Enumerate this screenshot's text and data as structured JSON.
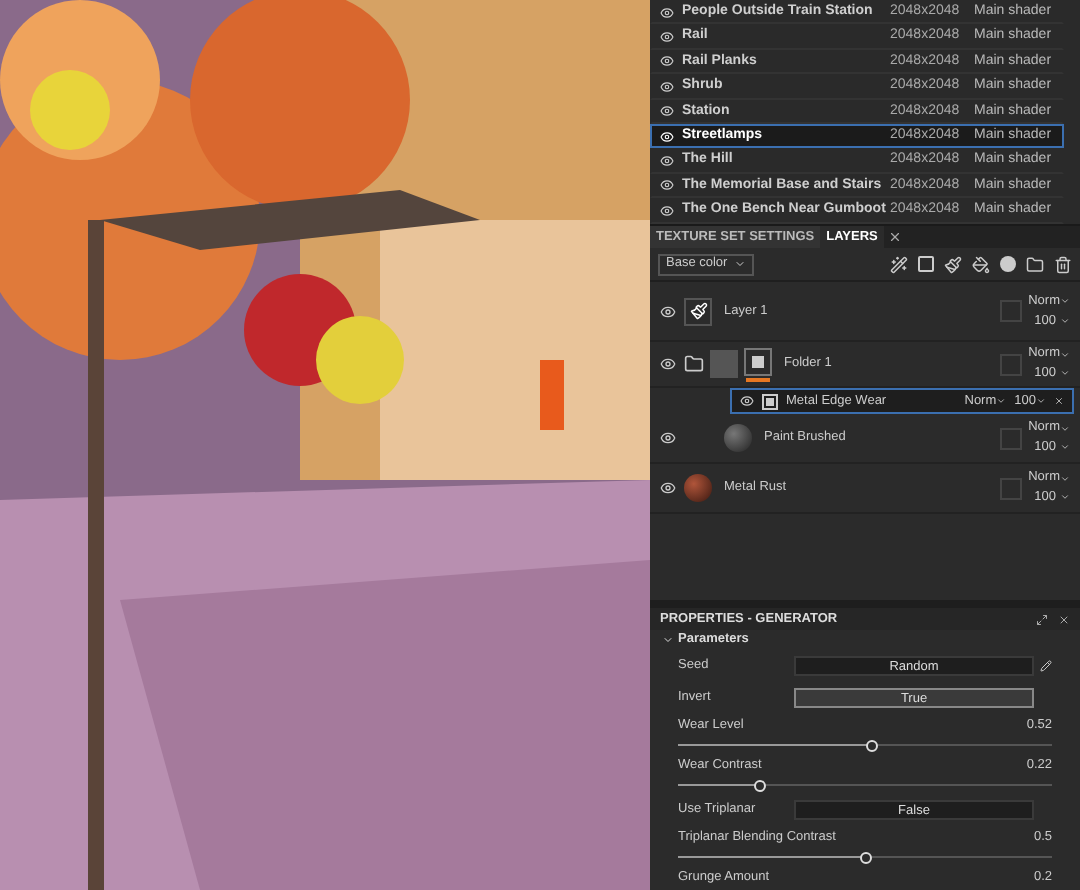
{
  "texture_sets": [
    {
      "name": "People Outside Train Station",
      "resolution": "2048x2048",
      "shader": "Main shader",
      "selected": false
    },
    {
      "name": "Rail",
      "resolution": "2048x2048",
      "shader": "Main shader",
      "selected": false
    },
    {
      "name": "Rail Planks",
      "resolution": "2048x2048",
      "shader": "Main shader",
      "selected": false
    },
    {
      "name": "Shrub",
      "resolution": "2048x2048",
      "shader": "Main shader",
      "selected": false
    },
    {
      "name": "Station",
      "resolution": "2048x2048",
      "shader": "Main shader",
      "selected": false
    },
    {
      "name": "Streetlamps",
      "resolution": "2048x2048",
      "shader": "Main shader",
      "selected": true
    },
    {
      "name": "The Hill",
      "resolution": "2048x2048",
      "shader": "Main shader",
      "selected": false
    },
    {
      "name": "The Memorial Base and Stairs",
      "resolution": "2048x2048",
      "shader": "Main shader",
      "selected": false
    },
    {
      "name": "The One Bench Near Gumboot",
      "resolution": "2048x2048",
      "shader": "Main shader",
      "selected": false
    }
  ],
  "layers_panel": {
    "tabs": [
      {
        "label": "TEXTURE SET SETTINGS",
        "selected": false
      },
      {
        "label": "LAYERS",
        "selected": true
      }
    ],
    "channel": "Base color",
    "layers": [
      {
        "name": "Layer 1",
        "kind": "paint",
        "blend": "Norm",
        "opacity": "100"
      },
      {
        "name": "Folder 1",
        "kind": "folder",
        "blend": "Norm",
        "opacity": "100",
        "children": [
          {
            "name": "Metal Edge Wear",
            "kind": "generator",
            "blend": "Norm",
            "opacity": "100",
            "selected": true
          }
        ]
      },
      {
        "name": "Paint Brushed",
        "kind": "fill",
        "blend": "Norm",
        "opacity": "100"
      },
      {
        "name": "Metal Rust",
        "kind": "rust",
        "blend": "Norm",
        "opacity": "100"
      }
    ]
  },
  "properties": {
    "title": "PROPERTIES - GENERATOR",
    "section": "Parameters",
    "expanded": true,
    "params": [
      {
        "kind": "button",
        "label": "Seed",
        "value": "Random"
      },
      {
        "kind": "toggle",
        "label": "Invert",
        "value": "True",
        "on": true
      },
      {
        "kind": "slider",
        "label": "Wear Level",
        "reading": "0.52",
        "level": 0.52
      },
      {
        "kind": "slider",
        "label": "Wear Contrast",
        "reading": "0.22",
        "level": 0.22
      },
      {
        "kind": "toggle",
        "label": "Use Triplanar",
        "value": "False",
        "on": false
      },
      {
        "kind": "slider",
        "label": "Triplanar Blending Contrast",
        "reading": "0.5",
        "level": 0.5
      },
      {
        "kind": "cut",
        "label": "Grunge Amount",
        "reading": "0.2"
      }
    ]
  }
}
